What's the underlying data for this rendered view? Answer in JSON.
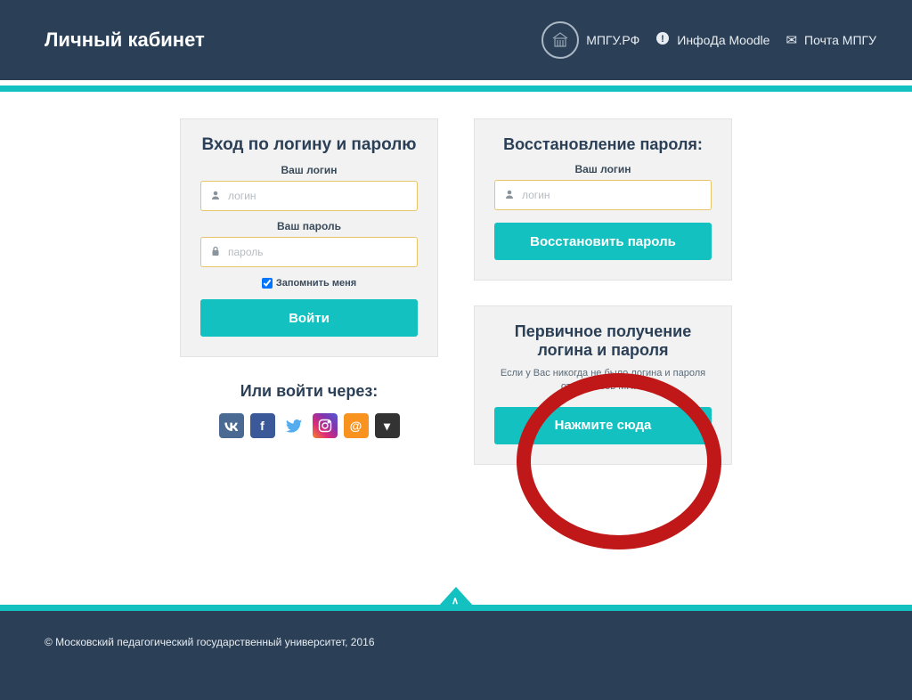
{
  "header": {
    "title": "Личный кабинет",
    "links": {
      "site": "МПГУ.РФ",
      "moodle": "ИнфоДа Moodle",
      "mail": "Почта МПГУ"
    }
  },
  "login_card": {
    "title": "Вход по логину и паролю",
    "login_label": "Ваш логин",
    "login_placeholder": "логин",
    "password_label": "Ваш пароль",
    "password_placeholder": "пароль",
    "remember": "Запомнить меня",
    "submit": "Войти"
  },
  "alt_login": {
    "title": "Или войти через:"
  },
  "recover_card": {
    "title": "Восстановление пароля:",
    "login_label": "Ваш логин",
    "login_placeholder": "логин",
    "submit": "Восстановить пароль"
  },
  "first_card": {
    "title": "Первичное получение логина и пароля",
    "help": "Если у Вас никогда не было логина и пароля от сервисов МПГУ",
    "submit": "Нажмите сюда"
  },
  "footer": {
    "copyright": "© Московский педагогический государственный университет, 2016"
  }
}
